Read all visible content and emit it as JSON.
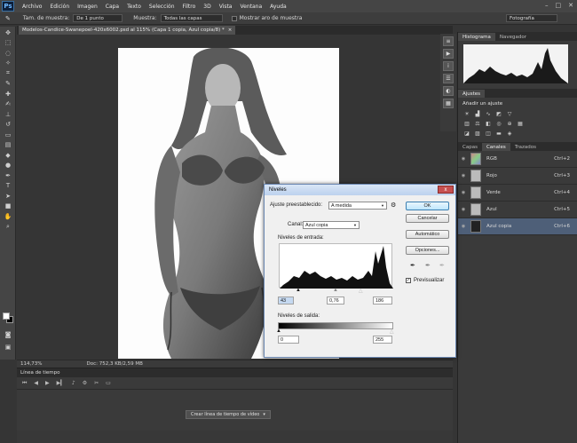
{
  "app": {
    "logo": "Ps"
  },
  "menu": [
    "Archivo",
    "Edición",
    "Imagen",
    "Capa",
    "Texto",
    "Selección",
    "Filtro",
    "3D",
    "Vista",
    "Ventana",
    "Ayuda"
  ],
  "options_bar": {
    "sample_size_label": "Tam. de muestra:",
    "sample_size_value": "De 1 punto",
    "sample_label": "Muestra:",
    "sample_value": "Todas las capas",
    "ring_label": "Mostrar aro de muestra",
    "workspace": "Fotografía"
  },
  "document": {
    "tab_title": "Modelos-Candice-Swanepoel-420x6002.psd al 115% (Capa 1 copia, Azul copia/8) *",
    "tab_close": "×"
  },
  "status": {
    "zoom": "114,73%",
    "doc": "Doc: 752,3 KB/2,59 MB"
  },
  "timeline": {
    "title": "Línea de tiempo",
    "button": "Crear línea de tiempo de vídeo"
  },
  "panels": {
    "histogram_tab": "Histograma",
    "navigator_tab": "Navegador",
    "adjustments_tab": "Ajustes",
    "adjustments_title": "Añadir un ajuste",
    "layers_tab": "Capas",
    "channels_tab": "Canales",
    "paths_tab": "Trazados",
    "channels": [
      {
        "name": "RGB",
        "shortcut": "Ctrl+2"
      },
      {
        "name": "Rojo",
        "shortcut": "Ctrl+3"
      },
      {
        "name": "Verde",
        "shortcut": "Ctrl+4"
      },
      {
        "name": "Azul",
        "shortcut": "Ctrl+5"
      },
      {
        "name": "Azul copia",
        "shortcut": "Ctrl+6"
      }
    ]
  },
  "levels": {
    "title": "Niveles",
    "preset_label": "Ajuste preestablecido:",
    "preset_value": "A medida",
    "channel_label": "Canal:",
    "channel_value": "Azul copia",
    "input_label": "Niveles de entrada:",
    "input_black": "43",
    "input_gamma": "0,76",
    "input_white": "186",
    "output_label": "Niveles de salida:",
    "output_black": "0",
    "output_white": "255",
    "ok": "OK",
    "cancel": "Cancelar",
    "auto": "Automático",
    "options": "Opciones...",
    "preview": "Previsualizar",
    "close": "x"
  }
}
